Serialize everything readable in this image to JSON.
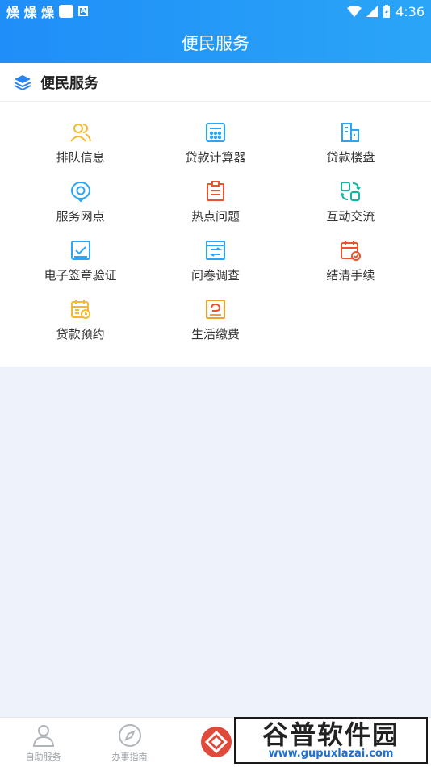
{
  "statusbar": {
    "left_glyphs": "燥 燥 燥",
    "badge": "A",
    "time": "4:36"
  },
  "header": {
    "title": "便民服务"
  },
  "section": {
    "title": "便民服务"
  },
  "services": [
    {
      "label": "排队信息",
      "icon": "users-icon",
      "color": "#f5b82e"
    },
    {
      "label": "贷款计算器",
      "icon": "calculator-icon",
      "color": "#2aa5f7"
    },
    {
      "label": "贷款楼盘",
      "icon": "building-icon",
      "color": "#2aa5f7"
    },
    {
      "label": "服务网点",
      "icon": "location-icon",
      "color": "#2aa5f7"
    },
    {
      "label": "热点问题",
      "icon": "clipboard-icon",
      "color": "#e8542f"
    },
    {
      "label": "互动交流",
      "icon": "exchange-icon",
      "color": "#17b4a0"
    },
    {
      "label": "电子签章验证",
      "icon": "check-seal-icon",
      "color": "#2aa5f7"
    },
    {
      "label": "问卷调查",
      "icon": "survey-icon",
      "color": "#2aa5f7"
    },
    {
      "label": "结清手续",
      "icon": "calendar-settle-icon",
      "color": "#e8542f"
    },
    {
      "label": "贷款预约",
      "icon": "calendar-clock-icon",
      "color": "#f5b82e"
    },
    {
      "label": "生活缴费",
      "icon": "bill-icon",
      "color": "#f0a22e"
    }
  ],
  "tabs": [
    {
      "label": "自助服务",
      "icon": "person-icon"
    },
    {
      "label": "办事指南",
      "icon": "compass-icon"
    },
    {
      "label": "",
      "icon": "home-logo-icon"
    }
  ],
  "watermark": {
    "line1": "谷普软件园",
    "line2": "www.gupuxlazai.com"
  }
}
